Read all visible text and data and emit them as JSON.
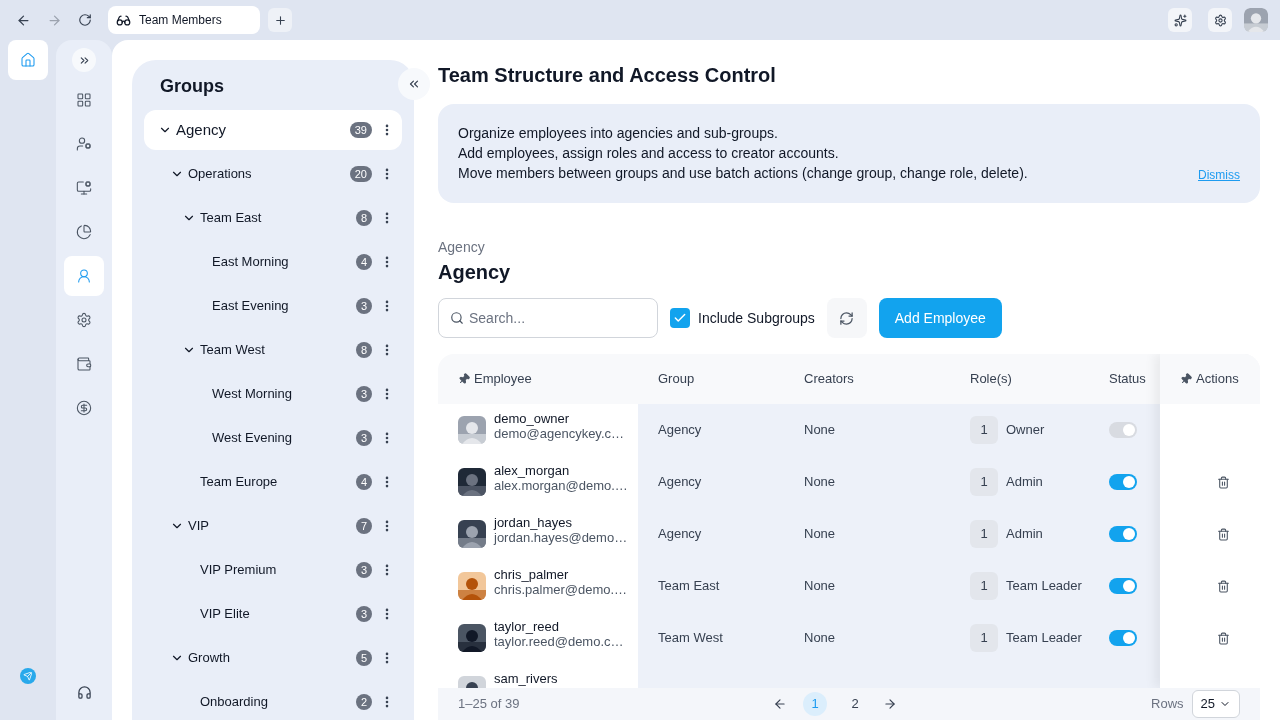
{
  "browser": {
    "tab_title": "Team Members"
  },
  "rail": [
    {
      "kind": "home",
      "selected": true
    }
  ],
  "nav": [
    {
      "kind": "grid",
      "selected": false
    },
    {
      "kind": "user-gear",
      "selected": false
    },
    {
      "kind": "monitor-gear",
      "selected": false
    },
    {
      "kind": "pie",
      "selected": false
    },
    {
      "kind": "team",
      "selected": true
    },
    {
      "kind": "settings",
      "selected": false
    },
    {
      "kind": "wallet",
      "selected": false
    },
    {
      "kind": "coin",
      "selected": false
    }
  ],
  "groups": {
    "title": "Groups",
    "tree": [
      {
        "label": "Agency",
        "count": "39",
        "expanded": true,
        "selected": true,
        "children": [
          {
            "label": "Operations",
            "count": "20",
            "expanded": true,
            "selected": false,
            "children": [
              {
                "label": "Team East",
                "count": "8",
                "expanded": true,
                "selected": false,
                "children": [
                  {
                    "label": "East Morning",
                    "count": "4",
                    "selected": false
                  },
                  {
                    "label": "East Evening",
                    "count": "3",
                    "selected": false
                  }
                ]
              },
              {
                "label": "Team West",
                "count": "8",
                "expanded": true,
                "selected": false,
                "children": [
                  {
                    "label": "West Morning",
                    "count": "3",
                    "selected": false
                  },
                  {
                    "label": "West Evening",
                    "count": "3",
                    "selected": false
                  }
                ]
              },
              {
                "label": "Team Europe",
                "count": "4",
                "selected": false
              }
            ]
          },
          {
            "label": "VIP",
            "count": "7",
            "expanded": true,
            "selected": false,
            "children": [
              {
                "label": "VIP Premium",
                "count": "3",
                "selected": false
              },
              {
                "label": "VIP Elite",
                "count": "3",
                "selected": false
              }
            ]
          },
          {
            "label": "Growth",
            "count": "5",
            "expanded": true,
            "selected": false,
            "children": [
              {
                "label": "Onboarding",
                "count": "2",
                "selected": false
              }
            ]
          }
        ]
      }
    ]
  },
  "page": {
    "title": "Team Structure and Access Control",
    "info_lines": [
      "Organize employees into agencies and sub-groups.",
      "Add employees, assign roles and access to creator accounts.",
      "Move members between groups and use batch actions (change group, change role, delete)."
    ],
    "dismiss": "Dismiss",
    "breadcrumb": "Agency",
    "heading": "Agency"
  },
  "toolbar": {
    "search_placeholder": "Search...",
    "include_subgroups": {
      "label": "Include Subgroups",
      "checked": true
    },
    "add_button": "Add Employee"
  },
  "table": {
    "columns": [
      "Employee",
      "Group",
      "Creators",
      "Role(s)",
      "Status",
      "Actions"
    ],
    "rows": [
      {
        "username": "demo_owner",
        "email": "demo@agencykey.c…",
        "group": "Agency",
        "creators": "None",
        "role_count": "1",
        "role": "Owner",
        "on": true,
        "disabled": true,
        "deletable": false
      },
      {
        "username": "alex_morgan",
        "email": "alex.morgan@demo.…",
        "group": "Agency",
        "creators": "None",
        "role_count": "1",
        "role": "Admin",
        "on": true,
        "disabled": false,
        "deletable": true
      },
      {
        "username": "jordan_hayes",
        "email": "jordan.hayes@demo…",
        "group": "Agency",
        "creators": "None",
        "role_count": "1",
        "role": "Admin",
        "on": true,
        "disabled": false,
        "deletable": true
      },
      {
        "username": "chris_palmer",
        "email": "chris.palmer@demo.…",
        "group": "Team East",
        "creators": "None",
        "role_count": "1",
        "role": "Team Leader",
        "on": true,
        "disabled": false,
        "deletable": true
      },
      {
        "username": "taylor_reed",
        "email": "taylor.reed@demo.c…",
        "group": "Team West",
        "creators": "None",
        "role_count": "1",
        "role": "Team Leader",
        "on": true,
        "disabled": false,
        "deletable": true
      },
      {
        "username": "sam_rivers"
      }
    ],
    "range": "1–25 of 39",
    "pages": [
      {
        "label": "1",
        "selected": true
      },
      {
        "label": "2",
        "selected": false
      }
    ],
    "rows_label": "Rows",
    "rows_value": "25"
  }
}
